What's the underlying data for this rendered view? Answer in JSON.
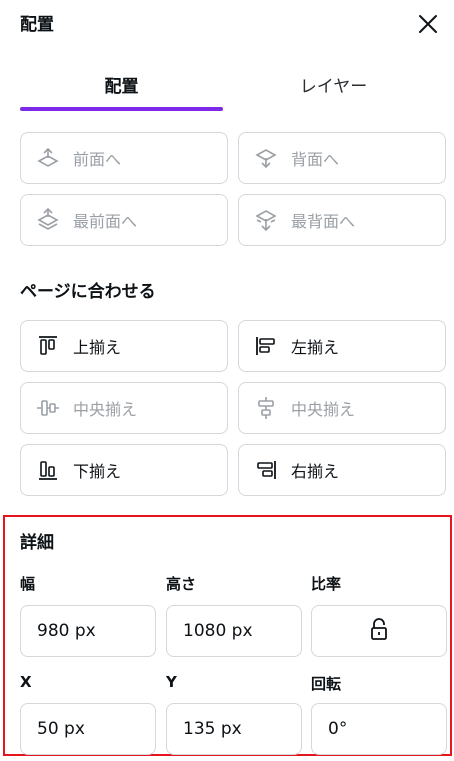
{
  "header": {
    "title": "配置"
  },
  "tabs": [
    {
      "label": "配置",
      "active": true
    },
    {
      "label": "レイヤー",
      "active": false
    }
  ],
  "layer_buttons": [
    {
      "label": "前面へ",
      "icon": "bring-forward-icon",
      "enabled": false
    },
    {
      "label": "背面へ",
      "icon": "send-backward-icon",
      "enabled": false
    },
    {
      "label": "最前面へ",
      "icon": "bring-to-front-icon",
      "enabled": false
    },
    {
      "label": "最背面へ",
      "icon": "send-to-back-icon",
      "enabled": false
    }
  ],
  "align_section": {
    "title": "ページに合わせる",
    "buttons": [
      {
        "label": "上揃え",
        "icon": "align-top-icon",
        "enabled": true
      },
      {
        "label": "左揃え",
        "icon": "align-left-icon",
        "enabled": true
      },
      {
        "label": "中央揃え",
        "icon": "align-vertical-center-icon",
        "enabled": false
      },
      {
        "label": "中央揃え",
        "icon": "align-horizontal-center-icon",
        "enabled": false
      },
      {
        "label": "下揃え",
        "icon": "align-bottom-icon",
        "enabled": true
      },
      {
        "label": "右揃え",
        "icon": "align-right-icon",
        "enabled": true
      }
    ]
  },
  "details": {
    "title": "詳細",
    "width": {
      "label": "幅",
      "value": "980 px"
    },
    "height": {
      "label": "高さ",
      "value": "1080 px"
    },
    "ratio": {
      "label": "比率",
      "icon": "lock-open-icon"
    },
    "x": {
      "label": "X",
      "value": "50 px"
    },
    "y": {
      "label": "Y",
      "value": "135 px"
    },
    "rotation": {
      "label": "回転",
      "value": "0°"
    }
  },
  "colors": {
    "accent": "#7d2ae8",
    "highlight_border": "#e5141f",
    "disabled_text": "#9aa0a6"
  }
}
